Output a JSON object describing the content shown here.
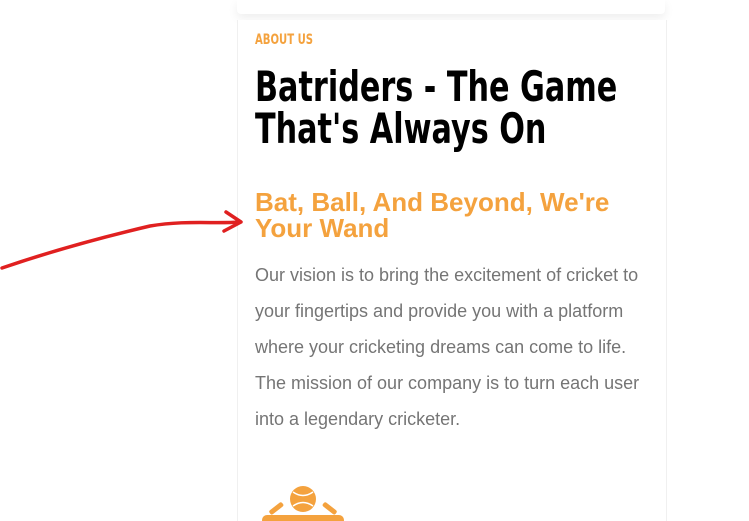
{
  "about": {
    "eyebrow": "ABOUT US",
    "title": "Batriders - The Game That's Always On",
    "subtitle": "Bat, Ball, And Beyond, We're Your Wand",
    "body": "Our vision is to bring the excitement of cricket to your fingertips and provide you with a platform where your cricketing dreams can come to life. The mission of our company is to turn each user into a legendary cricketer."
  },
  "annotation": {
    "arrow_color": "#e02020"
  },
  "icons": {
    "cricket": "cricket-bat-ball-icon"
  },
  "colors": {
    "accent": "#f4a23e",
    "heading": "#000000",
    "body": "#757575"
  }
}
